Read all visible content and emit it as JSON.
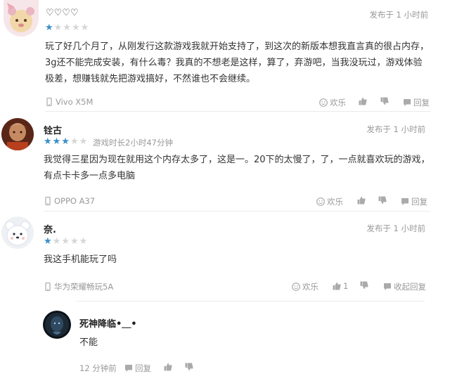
{
  "comments": [
    {
      "name": "♡♡♡♡",
      "time": "发布于 1 小时前",
      "rating": 1,
      "content": "玩了好几个月了，从刚发行这款游戏我就开始支持了，到这次的新版本想我直言真的很占内存，3g还不能完成安装，有什么毒？我真的不想老是这样，算了，弃游吧，当我没玩过，游戏体验极差，想赚钱就先把游戏搞好，不然谁也不会继续。",
      "device": "Vivo X5M",
      "emoji_label": "欢乐",
      "reply_label": "回复"
    },
    {
      "name": "铨古",
      "time": "发布于 1 小时前",
      "rating": 3,
      "playtime": "游戏时长2小时47分钟",
      "content": "我觉得三星因为现在就用这个内存太多了，这是一。20下的太慢了，了，一点就喜欢玩的游戏，有点卡卡多一点多电脑",
      "device": "OPPO A37",
      "emoji_label": "欢乐",
      "reply_label": "回复"
    },
    {
      "name": "奈.",
      "time": "发布于 1 小时前",
      "rating": 1,
      "content": "我这手机能玩了吗",
      "device": "华为荣耀畅玩5A",
      "emoji_label": "欢乐",
      "like_count": "1",
      "reply_label": "收起回复"
    }
  ],
  "reply": {
    "name": "死神降临•＿•",
    "content": "不能",
    "time": "12 分钟前",
    "reply_label": "回复"
  },
  "colors": {
    "star_on": "#3a8ec8",
    "star_off": "#d6d6d6",
    "muted": "#999999"
  }
}
